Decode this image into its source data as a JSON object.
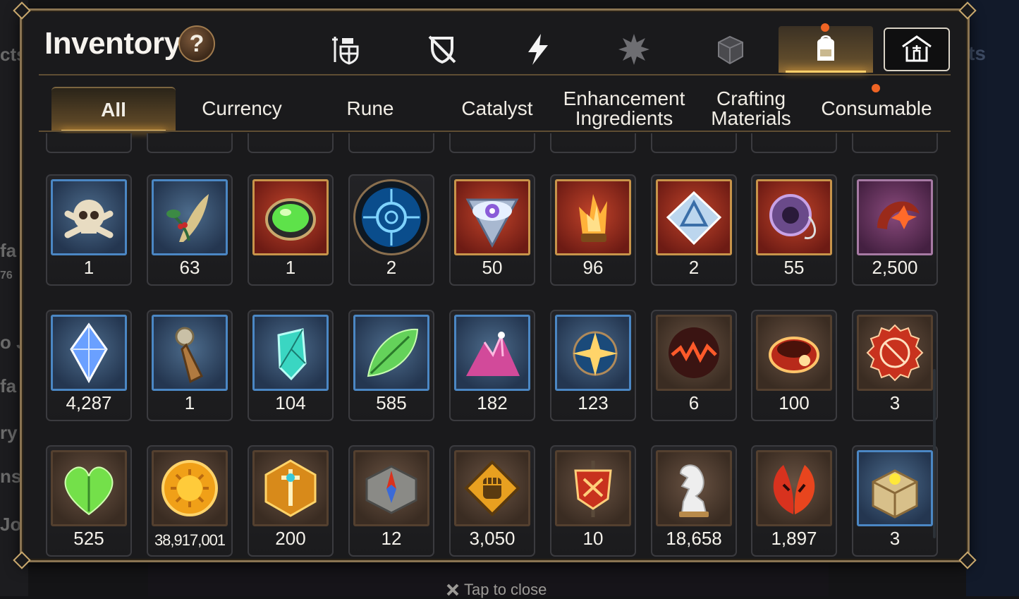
{
  "window": {
    "title": "Inventory",
    "help_label": "?",
    "close_hint": "Tap to close",
    "close_icon": "x-icon"
  },
  "category_tabs": [
    {
      "icon": "armored-knight-icon",
      "active": false,
      "badge": false
    },
    {
      "icon": "crossed-shield-icon",
      "active": false,
      "badge": false
    },
    {
      "icon": "lightning-icon",
      "active": false,
      "badge": false
    },
    {
      "icon": "spiked-emblem-icon",
      "active": false,
      "badge": false
    },
    {
      "icon": "cube-icon",
      "active": false,
      "badge": false
    },
    {
      "icon": "backpack-icon",
      "active": true,
      "badge": true
    },
    {
      "icon": "guild-house-icon",
      "active": false,
      "badge": false
    }
  ],
  "subtabs": [
    {
      "label": "All",
      "active": true,
      "badge": false
    },
    {
      "label": "Currency",
      "active": false,
      "badge": false
    },
    {
      "label": "Rune",
      "active": false,
      "badge": false
    },
    {
      "label": "Catalyst",
      "active": false,
      "badge": false
    },
    {
      "label": "Enhancement\nIngredients",
      "active": false,
      "badge": false
    },
    {
      "label": "Crafting\nMaterials",
      "active": false,
      "badge": false
    },
    {
      "label": "Consumable",
      "active": false,
      "badge": true
    }
  ],
  "items": [
    {
      "icon": "skull-crossbones-icon",
      "frame": "blue",
      "count": "1"
    },
    {
      "icon": "feather-herb-icon",
      "frame": "blue",
      "count": "63"
    },
    {
      "icon": "green-orb-icon",
      "frame": "red",
      "count": "1"
    },
    {
      "icon": "blue-rune-circle-icon",
      "frame": "round",
      "count": "2"
    },
    {
      "icon": "all-seeing-eye-icon",
      "frame": "red",
      "count": "50"
    },
    {
      "icon": "flame-crystal-icon",
      "frame": "red",
      "count": "96"
    },
    {
      "icon": "triquetra-crystal-icon",
      "frame": "red",
      "count": "2"
    },
    {
      "icon": "ring-pendant-icon",
      "frame": "red",
      "count": "55"
    },
    {
      "icon": "crescent-blossom-icon",
      "frame": "purple",
      "count": "2,500"
    },
    {
      "icon": "blue-gem-icon",
      "frame": "blue",
      "count": "4,287"
    },
    {
      "icon": "compass-pendant-icon",
      "frame": "blue",
      "count": "1"
    },
    {
      "icon": "teal-crystal-icon",
      "frame": "blue",
      "count": "104"
    },
    {
      "icon": "green-leaf-icon",
      "frame": "blue",
      "count": "585"
    },
    {
      "icon": "pink-crystal-pile-icon",
      "frame": "blue",
      "count": "182"
    },
    {
      "icon": "star-pendant-icon",
      "frame": "blue",
      "count": "123"
    },
    {
      "icon": "molten-orb-icon",
      "frame": "brown",
      "count": "6"
    },
    {
      "icon": "red-bracelet-icon",
      "frame": "brown",
      "count": "100"
    },
    {
      "icon": "red-seal-badge-icon",
      "frame": "brown",
      "count": "3"
    },
    {
      "icon": "green-heart-icon",
      "frame": "brown",
      "count": "525"
    },
    {
      "icon": "gold-sun-coin-icon",
      "frame": "brown",
      "count": "38,917,001"
    },
    {
      "icon": "gold-sword-emblem-icon",
      "frame": "brown",
      "count": "200"
    },
    {
      "icon": "stone-compass-icon",
      "frame": "brown",
      "count": "12"
    },
    {
      "icon": "fist-emblem-icon",
      "frame": "brown",
      "count": "3,050"
    },
    {
      "icon": "red-banner-icon",
      "frame": "brown",
      "count": "10"
    },
    {
      "icon": "chess-knight-icon",
      "frame": "brown",
      "count": "18,658"
    },
    {
      "icon": "red-leaves-icon",
      "frame": "brown",
      "count": "1,897"
    },
    {
      "icon": "treasure-box-icon",
      "frame": "blue",
      "count": "3"
    }
  ],
  "colors": {
    "accent_gold": "#ffcf6a",
    "badge_orange": "#ef6424",
    "frame_border": "#8a7452"
  },
  "background_fragments": {
    "left": [
      "cts",
      "fa",
      "76",
      "o J",
      "fa",
      "ry",
      "ns",
      "Jo"
    ],
    "right": "ts"
  }
}
